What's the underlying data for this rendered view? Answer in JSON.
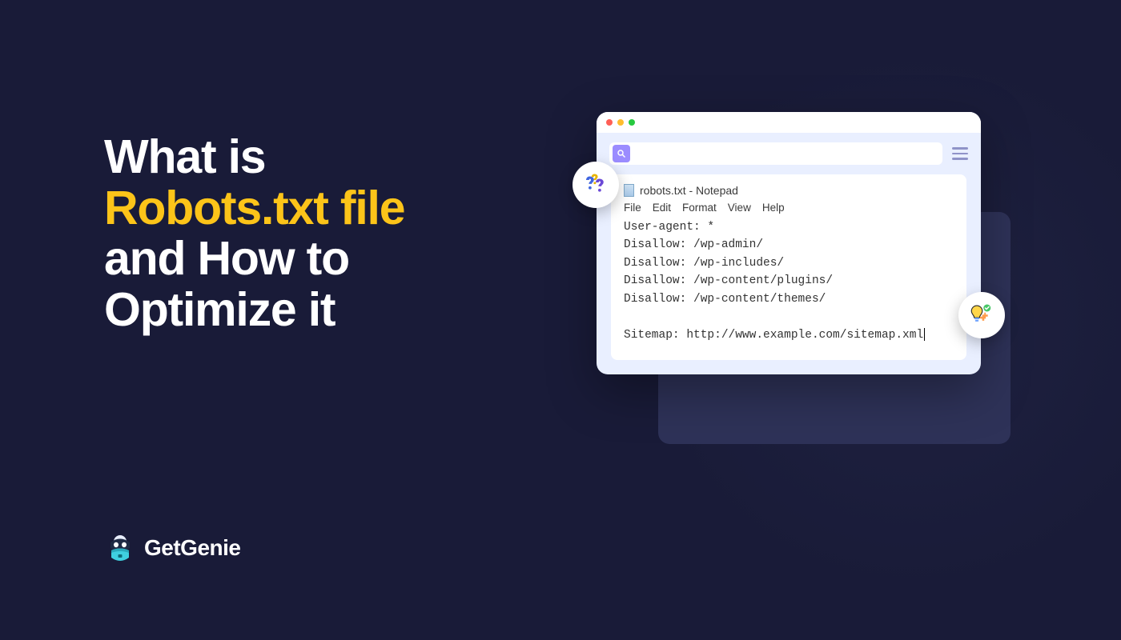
{
  "headline": {
    "line1": "What is",
    "line2": "Robots.txt file",
    "line3": "and How to",
    "line4": "Optimize it"
  },
  "brand": {
    "name": "GetGenie"
  },
  "browser": {
    "search_placeholder": ""
  },
  "notepad": {
    "title": "robots.txt - Notepad",
    "menu": [
      "File",
      "Edit",
      "Format",
      "View",
      "Help"
    ],
    "lines": [
      "User-agent: *",
      "Disallow: /wp-admin/",
      "Disallow: /wp-includes/",
      "Disallow: /wp-content/plugins/",
      "Disallow: /wp-content/themes/",
      "",
      "Sitemap: http://www.example.com/sitemap.xml"
    ]
  }
}
